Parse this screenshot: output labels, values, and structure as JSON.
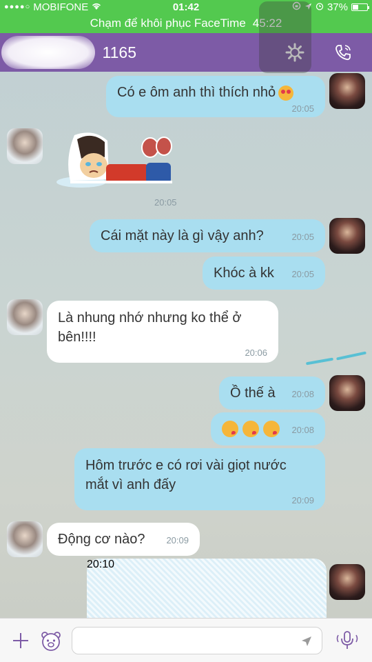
{
  "status_bar": {
    "signal_dots": "●●●●○",
    "carrier": "MOBIFONE",
    "time": "01:42",
    "battery_percent": "37%"
  },
  "facetime_banner": {
    "text": "Chạm để khôi phục FaceTime",
    "duration": "45:22"
  },
  "header": {
    "contact_suffix": "1165"
  },
  "messages": [
    {
      "side": "out",
      "text": "Có e ôm anh thì thích nhỏ",
      "time": "20:05"
    },
    {
      "side": "in",
      "type": "sticker",
      "time": "20:05"
    },
    {
      "side": "out",
      "text": "Cái mặt này là gì vậy anh?",
      "time": "20:05"
    },
    {
      "side": "out",
      "text": "Khóc à kk",
      "time": "20:05"
    },
    {
      "side": "in",
      "text_line1": "Là nhung nhớ nhưng ko thể ở",
      "text_line2": "bên!!!!",
      "time": "20:06"
    },
    {
      "side": "out",
      "text": "Ồ thế à",
      "time": "20:08"
    },
    {
      "side": "out",
      "type": "emoji",
      "time": "20:08"
    },
    {
      "side": "out",
      "text_line1": "Hôm trước e có rơi vài giọt nước",
      "text_line2": "mắt vì anh đấy",
      "time": "20:09"
    },
    {
      "side": "in",
      "text": "Động cơ nào?",
      "time": "20:09"
    },
    {
      "side": "out",
      "type": "redacted",
      "time": "20:10"
    }
  ],
  "colors": {
    "status_green": "#53c94f",
    "header_purple": "#7d5ba6",
    "bubble_out": "#a9def0",
    "bubble_in": "#ffffff"
  }
}
